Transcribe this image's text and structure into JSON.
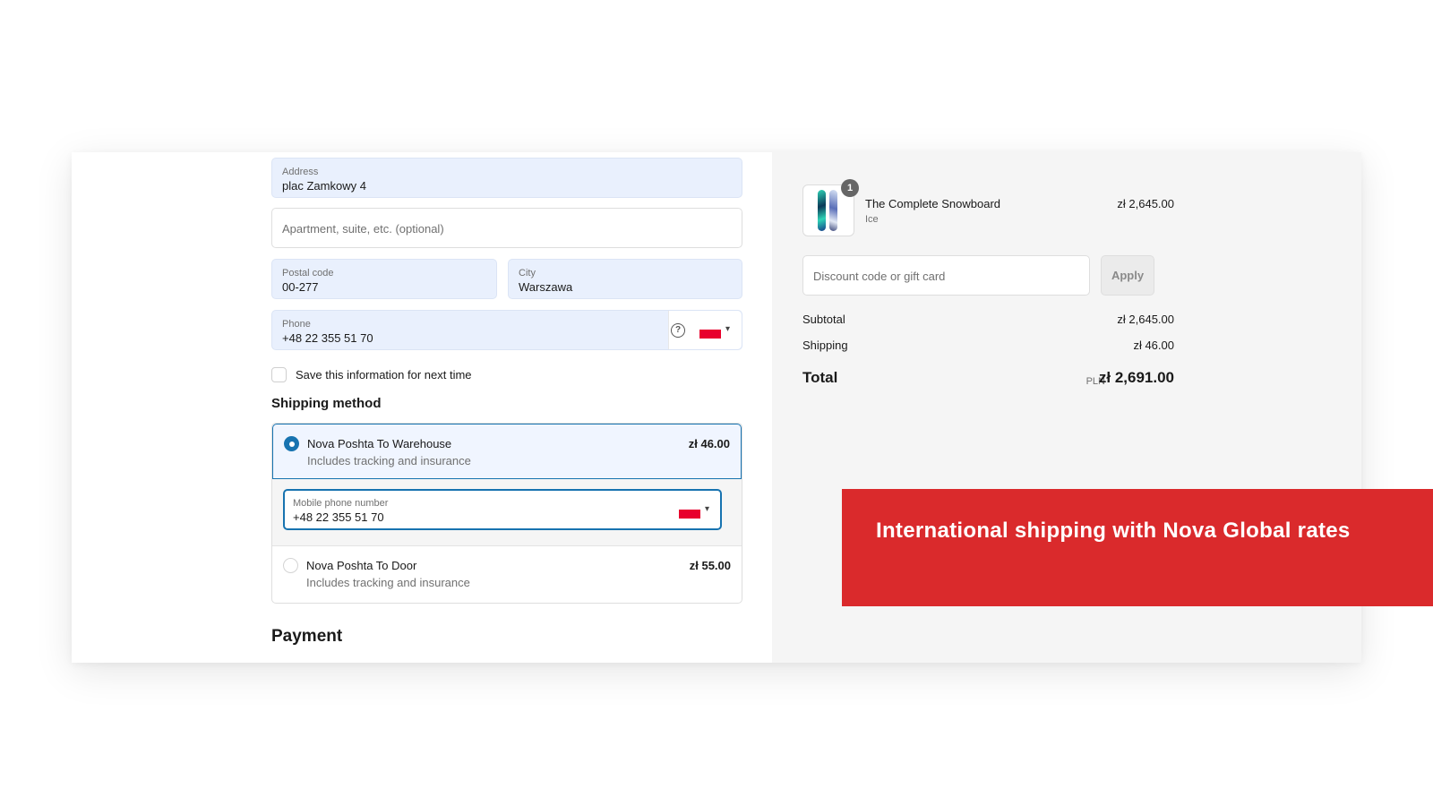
{
  "address": {
    "label": "Address",
    "value": "plac Zamkowy 4"
  },
  "apartment": {
    "placeholder": "Apartment, suite, etc. (optional)"
  },
  "postal_code": {
    "label": "Postal code",
    "value": "00-277"
  },
  "city": {
    "label": "City",
    "value": "Warszawa"
  },
  "phone": {
    "label": "Phone",
    "value": "+48 22 355 51 70",
    "help_icon": "?"
  },
  "save_info": {
    "label": "Save this information for next time",
    "checked": false
  },
  "shipping": {
    "title": "Shipping method",
    "options": [
      {
        "name": "Nova Poshta To Warehouse",
        "description": "Includes tracking and insurance",
        "price": "zł 46.00",
        "selected": true
      },
      {
        "name": "Nova Poshta To Door",
        "description": "Includes tracking and insurance",
        "price": "zł 55.00",
        "selected": false
      }
    ],
    "mobile": {
      "label": "Mobile phone number",
      "value": "+48 22 355 51 70"
    }
  },
  "payment": {
    "title": "Payment"
  },
  "order": {
    "item": {
      "name": "The Complete Snowboard",
      "variant": "Ice",
      "price": "zł 2,645.00",
      "quantity": "1"
    },
    "discount_placeholder": "Discount code or gift card",
    "apply_label": "Apply",
    "subtotal_label": "Subtotal",
    "subtotal_value": "zł 2,645.00",
    "shipping_label": "Shipping",
    "shipping_value": "zł 46.00",
    "total_label": "Total",
    "currency": "PLN",
    "total_value": "zł 2,691.00"
  },
  "banner": {
    "text": "International shipping with Nova Global rates"
  },
  "colors": {
    "accent": "#1773b0",
    "banner": "#da2a2c",
    "filled_field": "#e9f0fd",
    "flag_red": "#e8002d"
  }
}
